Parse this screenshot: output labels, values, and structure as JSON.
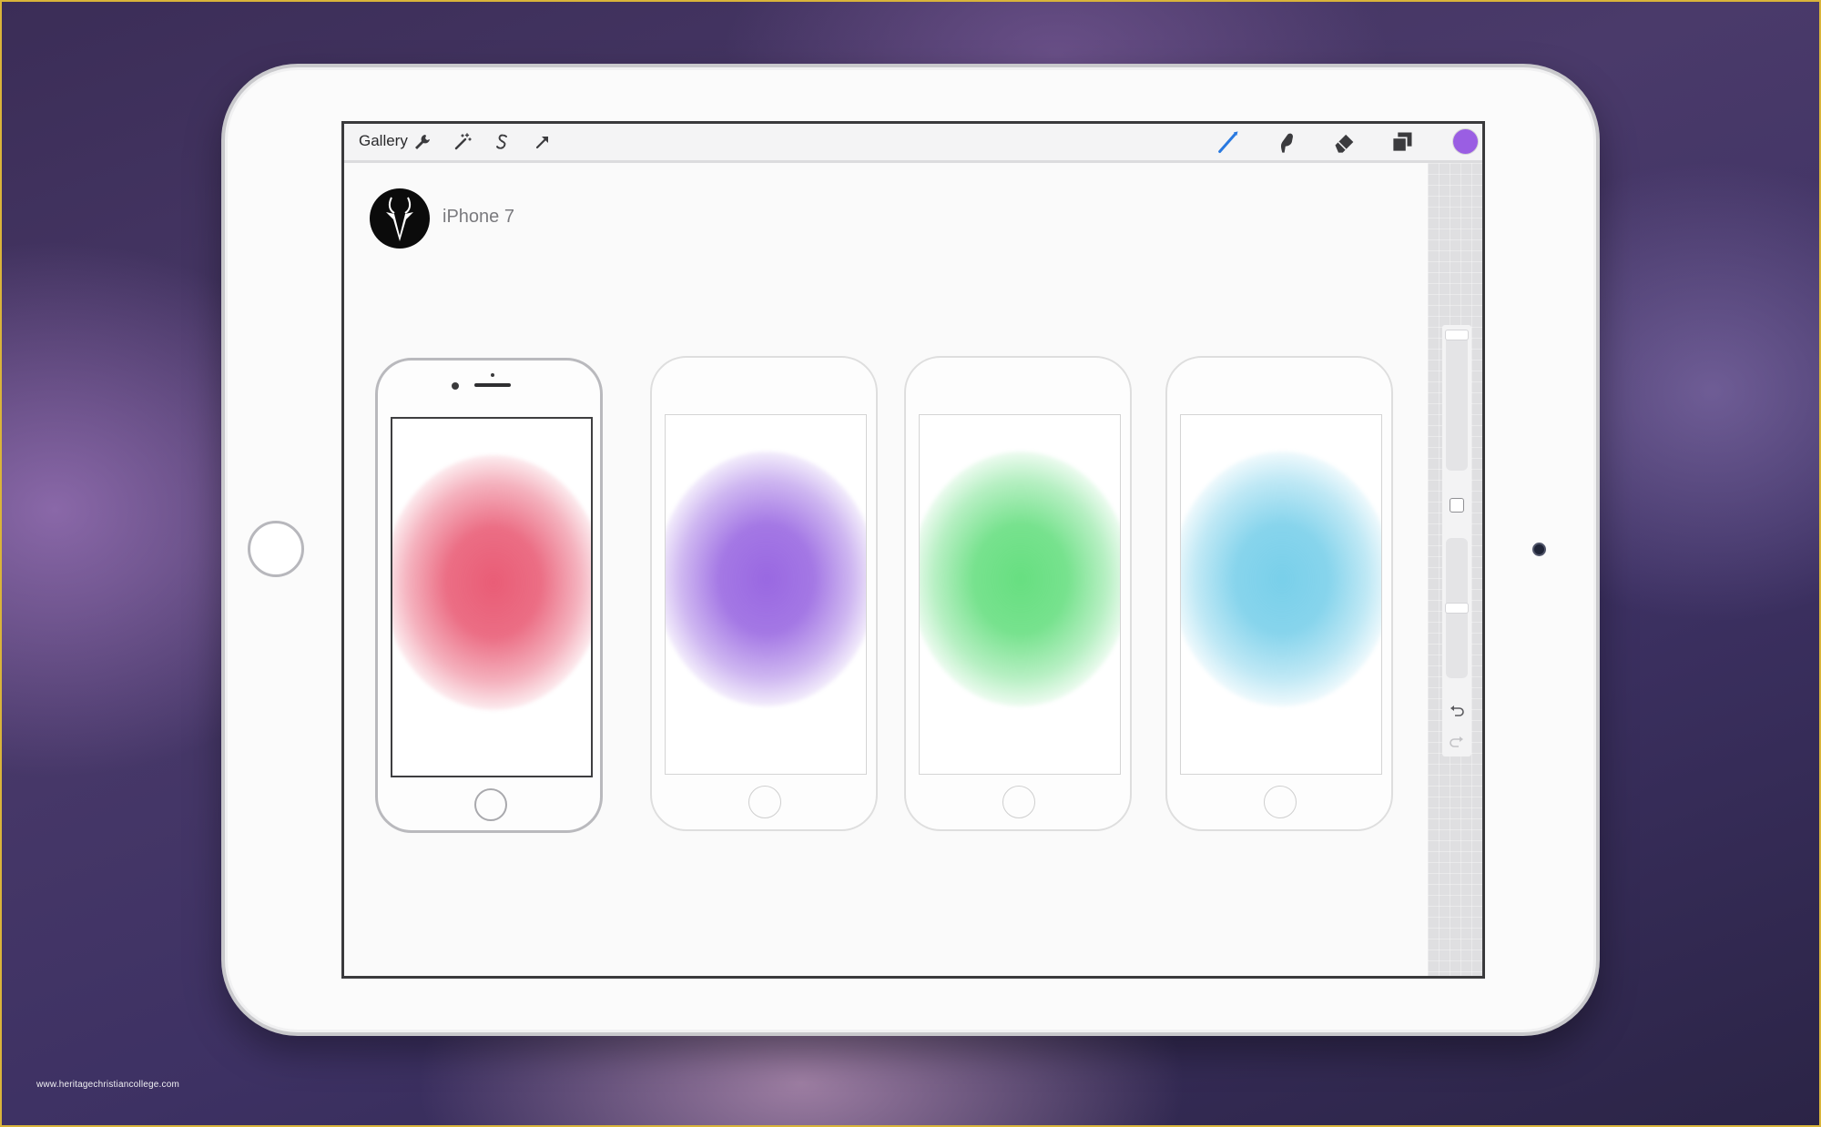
{
  "toolbar": {
    "gallery_label": "Gallery",
    "left_tools": [
      "wrench-icon",
      "magic-wand-icon",
      "selection-icon",
      "transform-arrow-icon"
    ],
    "right_tools": [
      "brush-icon",
      "smudge-icon",
      "eraser-icon",
      "layers-icon"
    ],
    "current_color": "#9a5ee3"
  },
  "project": {
    "title": "iPhone 7",
    "avatar_icon": "antelope-logo-icon"
  },
  "phones": [
    {
      "splash_color": "#e8546f",
      "selected": true
    },
    {
      "splash_color": "#9460e0",
      "selected": false
    },
    {
      "splash_color": "#5fdd7a",
      "selected": false
    },
    {
      "splash_color": "#72cde9",
      "selected": false
    }
  ],
  "side_panel": {
    "controls": [
      "brush-size-slider",
      "modify-button",
      "opacity-slider",
      "undo-icon",
      "redo-icon"
    ]
  },
  "watermark": "www.heritagechristiancollege.com"
}
